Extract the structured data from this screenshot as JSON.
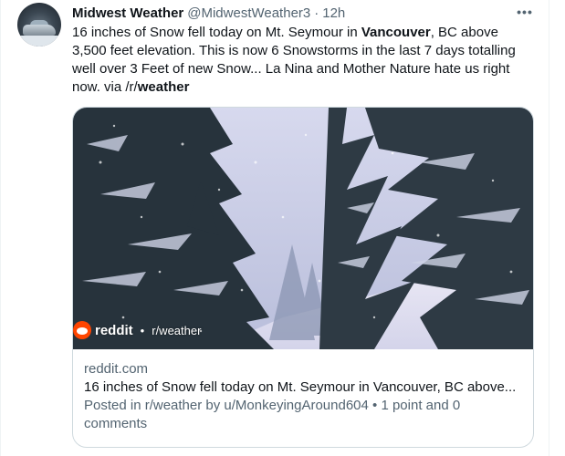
{
  "tweet": {
    "display_name": "Midwest Weather",
    "handle": "@MidwestWeather3",
    "separator": "·",
    "time": "12h",
    "more_label": "•••",
    "text": {
      "part1": "16 inches of Snow fell today on Mt. Seymour in ",
      "bold1": "Vancouver",
      "part2": ", BC above 3,500 feet elevation. This is now 6 Snowstorms in the last 7 days totalling well over 3 Feet of new Snow... La Nina and Mother Nature hate us right now. via ",
      "link_prefix": "/r/",
      "link_bold": "weather"
    }
  },
  "card": {
    "overlay": {
      "brand": "reddit",
      "separator": "•",
      "subreddit": "r/weather"
    },
    "domain": "reddit.com",
    "title": "16 inches of Snow fell today on Mt. Seymour in Vancouver, BC above...",
    "description": "Posted in r/weather by u/MonkeyingAround604 • 1 point and 0 comments"
  },
  "colors": {
    "text_primary": "#0f1419",
    "text_secondary": "#536471",
    "border": "#cfd9de",
    "reddit_orange": "#ff4500"
  },
  "icons": {
    "more": "more-horizontal-icon",
    "reddit": "reddit-logo-icon"
  }
}
